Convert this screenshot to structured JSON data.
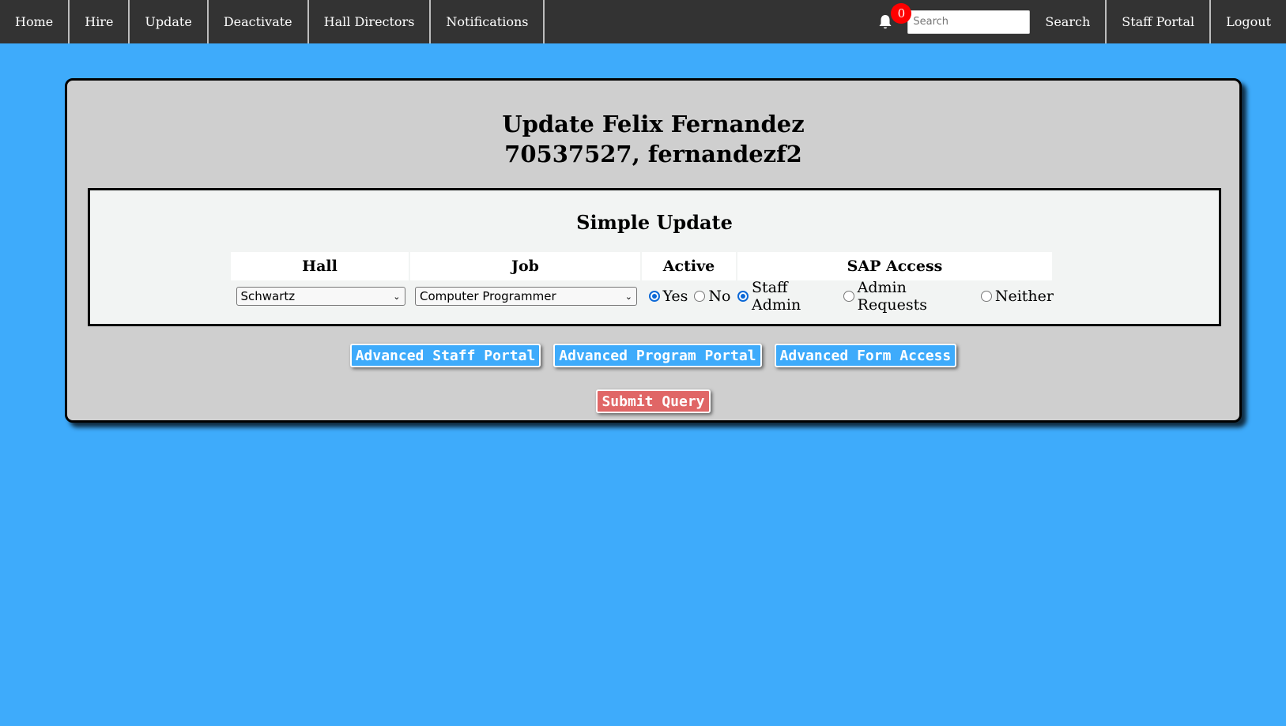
{
  "nav": {
    "left": [
      "Home",
      "Hire",
      "Update",
      "Deactivate",
      "Hall Directors",
      "Notifications"
    ],
    "notification_count": "0",
    "search_placeholder": "Search",
    "search_button": "Search",
    "staff_portal": "Staff Portal",
    "logout": "Logout"
  },
  "card": {
    "title_line1": "Update Felix Fernandez",
    "title_line2": "70537527, fernandezf2"
  },
  "simple_update": {
    "title": "Simple Update",
    "headers": {
      "hall": "Hall",
      "job": "Job",
      "active": "Active",
      "sap": "SAP Access"
    },
    "hall_value": "Schwartz",
    "job_value": "Computer Programmer",
    "active_options": [
      "Yes",
      "No"
    ],
    "active_selected": "Yes",
    "sap_options": [
      "Staff Admin",
      "Admin Requests",
      "Neither"
    ],
    "sap_selected": "Staff Admin"
  },
  "buttons": {
    "advanced_staff": "Advanced Staff Portal",
    "advanced_program": "Advanced Program Portal",
    "advanced_form": "Advanced Form Access",
    "submit": "Submit Query"
  },
  "colors": {
    "background": "#3eabfb",
    "nav": "#333333",
    "card": "#cfcfcf",
    "submit": "#e06666",
    "badge": "#ff0000"
  }
}
